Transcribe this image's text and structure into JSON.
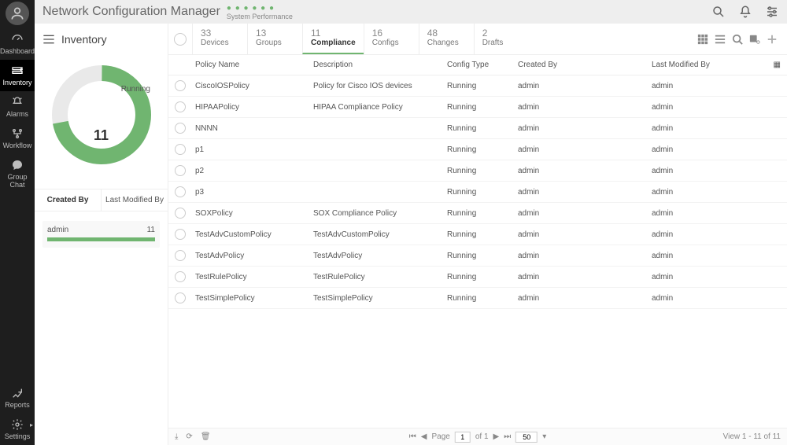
{
  "header": {
    "brand": "Network Configuration Manager",
    "perf_label": "System Performance"
  },
  "nav": [
    {
      "label": "Dashboard"
    },
    {
      "label": "Inventory"
    },
    {
      "label": "Alarms"
    },
    {
      "label": "Workflow"
    },
    {
      "label": "Group Chat"
    }
  ],
  "nav_bottom": [
    {
      "label": "Reports"
    },
    {
      "label": "Settings"
    }
  ],
  "side": {
    "title": "Inventory",
    "donut_center": "11",
    "donut_label": "Running",
    "tabs": {
      "created": "Created By",
      "modified": "Last Modified By"
    },
    "filter": {
      "label": "admin",
      "value": "11"
    }
  },
  "tabs": [
    {
      "count": "33",
      "label": "Devices"
    },
    {
      "count": "13",
      "label": "Groups"
    },
    {
      "count": "11",
      "label": "Compliance"
    },
    {
      "count": "16",
      "label": "Configs"
    },
    {
      "count": "48",
      "label": "Changes"
    },
    {
      "count": "2",
      "label": "Drafts"
    }
  ],
  "columns": {
    "policy": "Policy Name",
    "desc": "Description",
    "config": "Config Type",
    "created": "Created By",
    "modified": "Last Modified By"
  },
  "rows": [
    {
      "policy": "CiscoIOSPolicy",
      "desc": "Policy for Cisco IOS devices",
      "config": "Running",
      "created": "admin",
      "modified": "admin"
    },
    {
      "policy": "HIPAAPolicy",
      "desc": "HIPAA Compliance Policy",
      "config": "Running",
      "created": "admin",
      "modified": "admin"
    },
    {
      "policy": "NNNN",
      "desc": "",
      "config": "Running",
      "created": "admin",
      "modified": "admin"
    },
    {
      "policy": "p1",
      "desc": "",
      "config": "Running",
      "created": "admin",
      "modified": "admin"
    },
    {
      "policy": "p2",
      "desc": "",
      "config": "Running",
      "created": "admin",
      "modified": "admin"
    },
    {
      "policy": "p3",
      "desc": "",
      "config": "Running",
      "created": "admin",
      "modified": "admin"
    },
    {
      "policy": "SOXPolicy",
      "desc": "SOX Compliance Policy",
      "config": "Running",
      "created": "admin",
      "modified": "admin"
    },
    {
      "policy": "TestAdvCustomPolicy",
      "desc": "TestAdvCustomPolicy",
      "config": "Running",
      "created": "admin",
      "modified": "admin"
    },
    {
      "policy": "TestAdvPolicy",
      "desc": "TestAdvPolicy",
      "config": "Running",
      "created": "admin",
      "modified": "admin"
    },
    {
      "policy": "TestRulePolicy",
      "desc": "TestRulePolicy",
      "config": "Running",
      "created": "admin",
      "modified": "admin"
    },
    {
      "policy": "TestSimplePolicy",
      "desc": "TestSimplePolicy",
      "config": "Running",
      "created": "admin",
      "modified": "admin"
    }
  ],
  "footer": {
    "page_word": "Page",
    "page_num": "1",
    "page_of": "of 1",
    "page_size": "50",
    "view": "View 1 - 11 of 11"
  },
  "chart_data": {
    "type": "pie",
    "title": "",
    "series": [
      {
        "name": "Running",
        "value": 11,
        "color": "#70b570"
      }
    ],
    "total": 11,
    "center_label": "11"
  },
  "colors": {
    "accent": "#70b570",
    "nav_bg": "#1e1e1e",
    "border": "#eeeeee"
  }
}
